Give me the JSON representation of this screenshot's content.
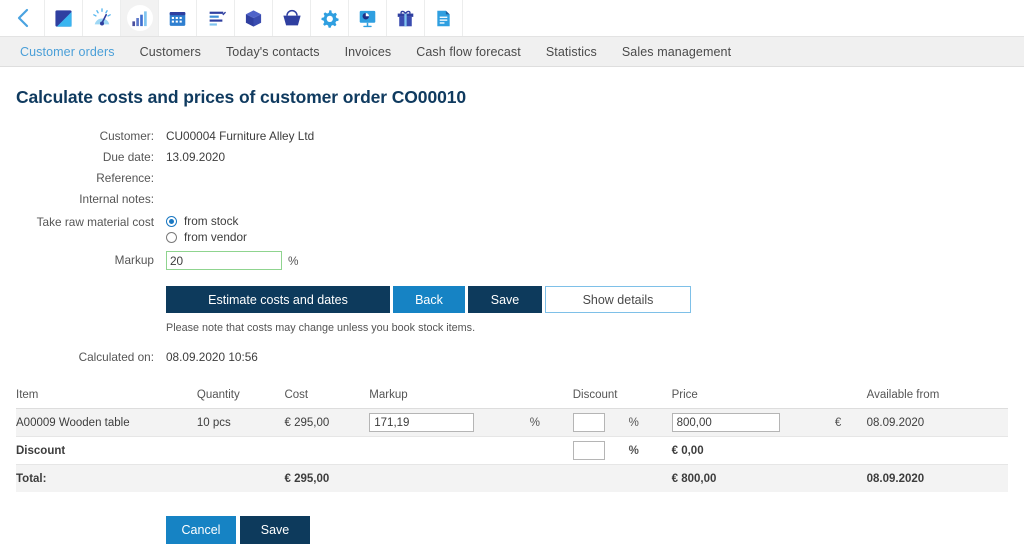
{
  "appbar": {
    "back_icon": "chevron-left-icon",
    "tiles": [
      {
        "icon": "dashboard-square-icon",
        "active": false
      },
      {
        "icon": "gauge-icon",
        "active": false
      },
      {
        "icon": "bar-chart-icon",
        "active": true
      },
      {
        "icon": "calendar-icon",
        "active": false
      },
      {
        "icon": "task-list-icon",
        "active": false
      },
      {
        "icon": "cube-icon",
        "active": false
      },
      {
        "icon": "basket-icon",
        "active": false
      },
      {
        "icon": "gear-icon",
        "active": false
      },
      {
        "icon": "presentation-icon",
        "active": false
      },
      {
        "icon": "gift-icon",
        "active": false
      },
      {
        "icon": "document-icon",
        "active": false
      }
    ]
  },
  "nav": {
    "tabs": [
      {
        "label": "Customer orders",
        "active": true
      },
      {
        "label": "Customers",
        "active": false
      },
      {
        "label": "Today's contacts",
        "active": false
      },
      {
        "label": "Invoices",
        "active": false
      },
      {
        "label": "Cash flow forecast",
        "active": false
      },
      {
        "label": "Statistics",
        "active": false
      },
      {
        "label": "Sales management",
        "active": false
      }
    ]
  },
  "page": {
    "title": "Calculate costs and prices of customer order CO00010"
  },
  "form": {
    "customer_label": "Customer:",
    "customer_value": "CU00004 Furniture Alley Ltd",
    "due_date_label": "Due date:",
    "due_date_value": "13.09.2020",
    "reference_label": "Reference:",
    "reference_value": "",
    "internal_notes_label": "Internal notes:",
    "internal_notes_value": "",
    "raw_material_label": "Take raw material cost",
    "raw_from_stock": "from stock",
    "raw_from_vendor": "from vendor",
    "markup_label": "Markup",
    "markup_value": "20",
    "markup_placeholder": "",
    "percent_symbol": "%",
    "calculated_on_label": "Calculated on:",
    "calculated_on_value": "08.09.2020 10:56"
  },
  "buttons": {
    "estimate": "Estimate costs and dates",
    "back": "Back",
    "save": "Save",
    "show_details": "Show details",
    "note": "Please note that costs may change unless you book stock items.",
    "cancel": "Cancel",
    "save_bottom": "Save"
  },
  "table": {
    "headers": {
      "item": "Item",
      "quantity": "Quantity",
      "cost": "Cost",
      "markup": "Markup",
      "discount": "Discount",
      "price": "Price",
      "available_from": "Available from"
    },
    "rows": [
      {
        "item": "A00009 Wooden table",
        "quantity": "10 pcs",
        "cost": "€ 295,00",
        "markup": "171,19",
        "markup_pct": "%",
        "discount": "",
        "discount_pct": "%",
        "price": "800,00",
        "price_currency": "€",
        "available_from": "08.09.2020"
      }
    ],
    "discount_row": {
      "label": "Discount",
      "discount": "",
      "discount_pct": "%",
      "price": "€ 0,00"
    },
    "total_row": {
      "label": "Total:",
      "cost": "€ 295,00",
      "price": "€ 800,00",
      "available_from": "08.09.2020"
    }
  },
  "colors": {
    "navy": "#0d3a5c",
    "blue": "#1683c4",
    "tab_active": "#4a9fd8",
    "title": "#0f3a5f",
    "input_valid_border": "#8fd48f",
    "row_bg": "#f3f3f3",
    "navbar_bg": "#f0f0f0"
  }
}
